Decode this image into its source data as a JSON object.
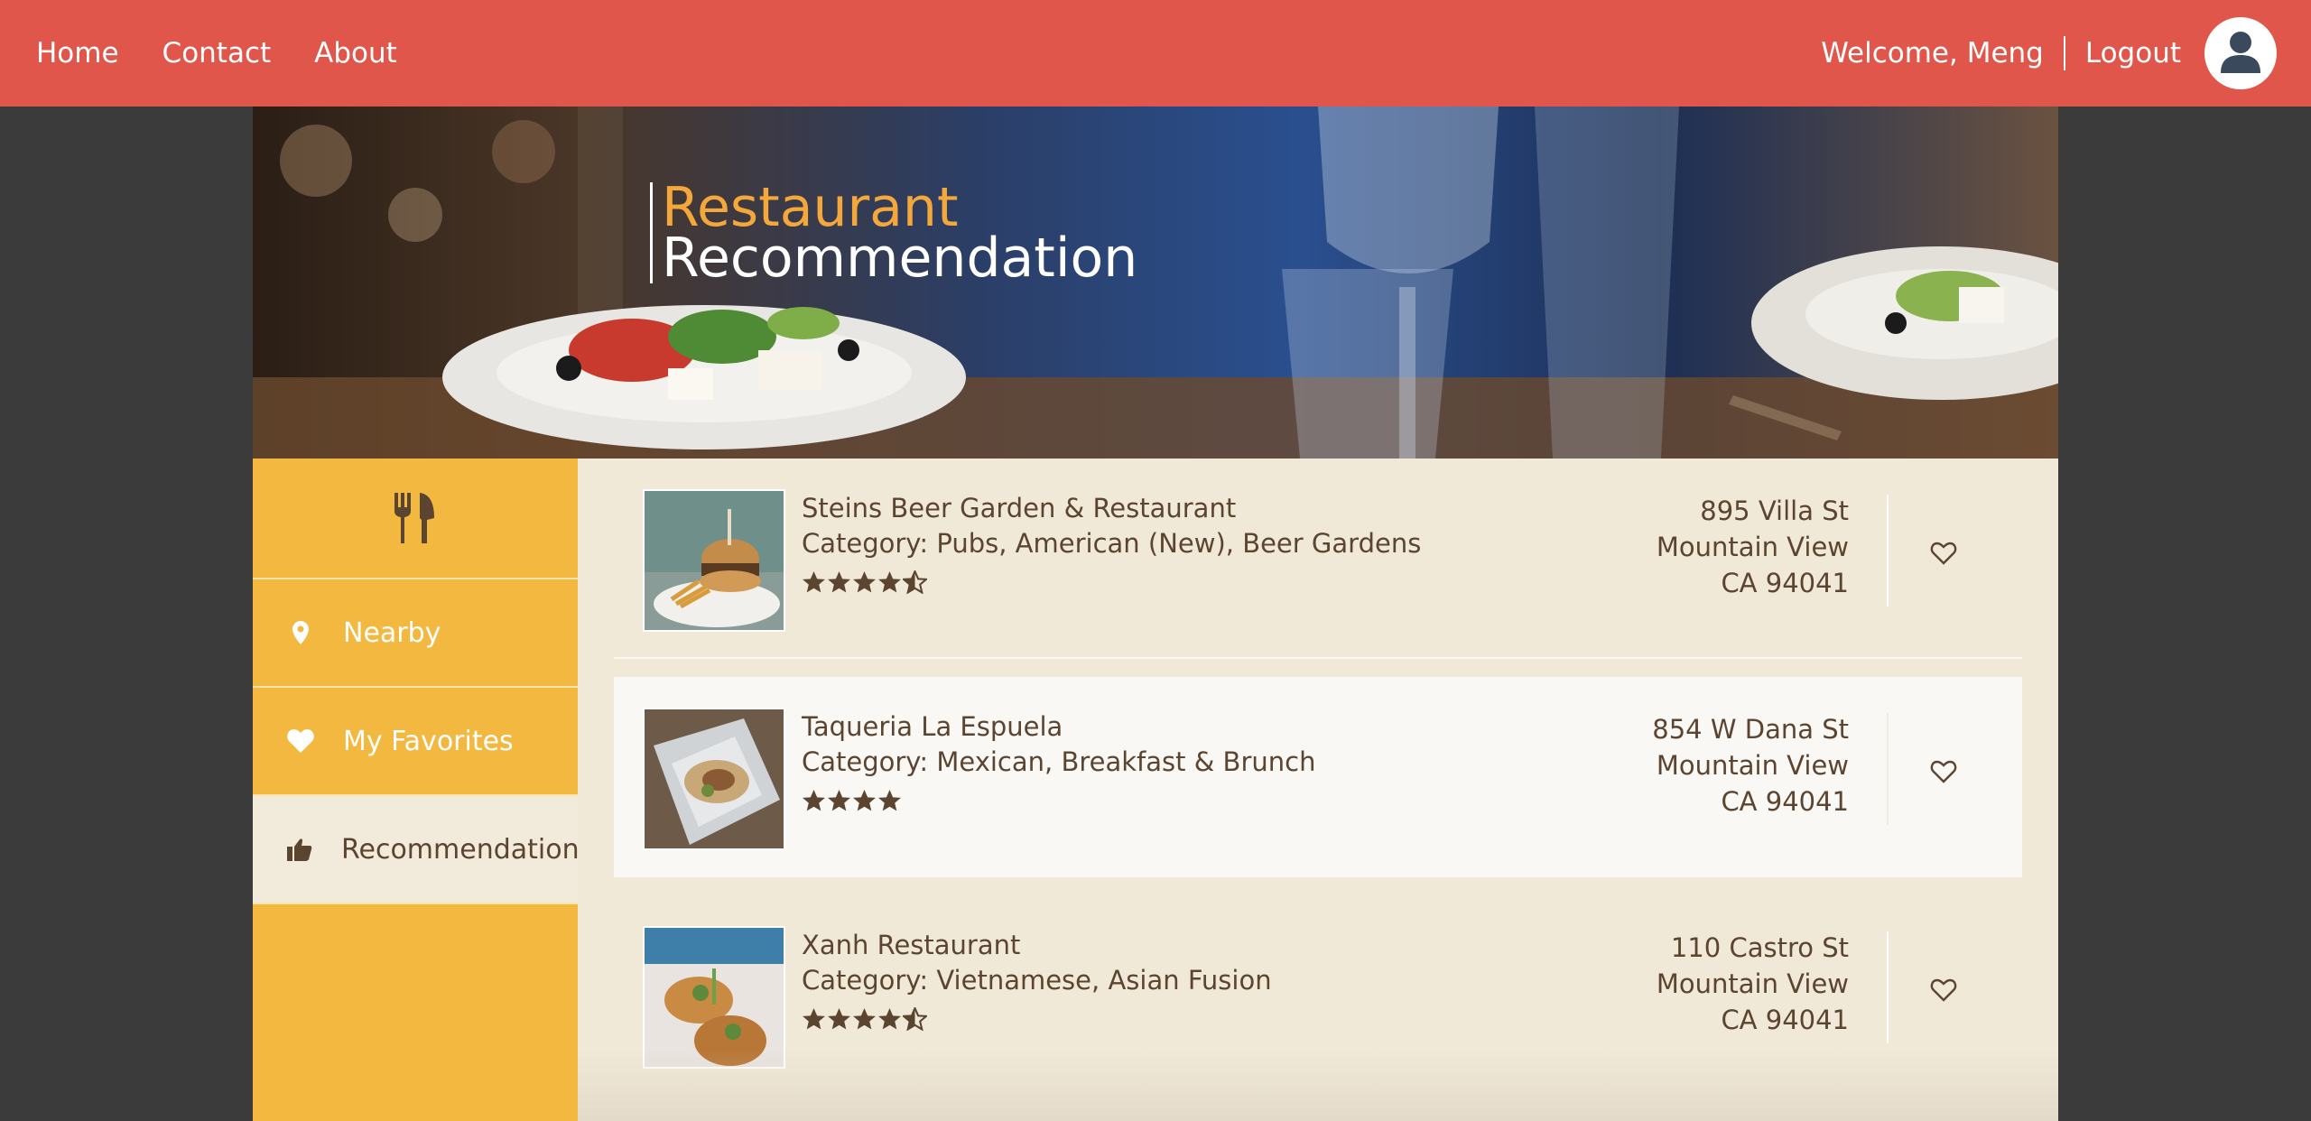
{
  "nav": {
    "links": [
      "Home",
      "Contact",
      "About"
    ],
    "welcome": "Welcome, Meng",
    "logout": "Logout"
  },
  "hero": {
    "title_line1": "Restaurant",
    "title_line2": "Recommendation"
  },
  "sidebar": {
    "items": [
      {
        "label": "Nearby",
        "icon": "map-pin-icon"
      },
      {
        "label": "My Favorites",
        "icon": "heart-icon"
      },
      {
        "label": "Recommendation",
        "icon": "thumbs-up-icon"
      }
    ],
    "active": "Recommendation"
  },
  "restaurants": [
    {
      "name": "Steins Beer Garden & Restaurant",
      "category": "Category: Pubs, American (New), Beer Gardens",
      "rating": 4.5,
      "address_line1": "895 Villa St",
      "address_line2": "Mountain View",
      "address_line3": "CA 94041"
    },
    {
      "name": "Taqueria La Espuela",
      "category": "Category: Mexican, Breakfast & Brunch",
      "rating": 4,
      "address_line1": "854 W Dana St",
      "address_line2": "Mountain View",
      "address_line3": "CA 94041"
    },
    {
      "name": "Xanh Restaurant",
      "category": "Category: Vietnamese, Asian Fusion",
      "rating": 4.5,
      "address_line1": "110 Castro St",
      "address_line2": "Mountain View",
      "address_line3": "CA 94041"
    }
  ],
  "colors": {
    "nav_bg": "#e0564a",
    "sidebar_bg": "#f2b840",
    "content_bg": "#f1e9d8",
    "text_brown": "#5b4430",
    "accent_orange": "#f4a73b"
  }
}
